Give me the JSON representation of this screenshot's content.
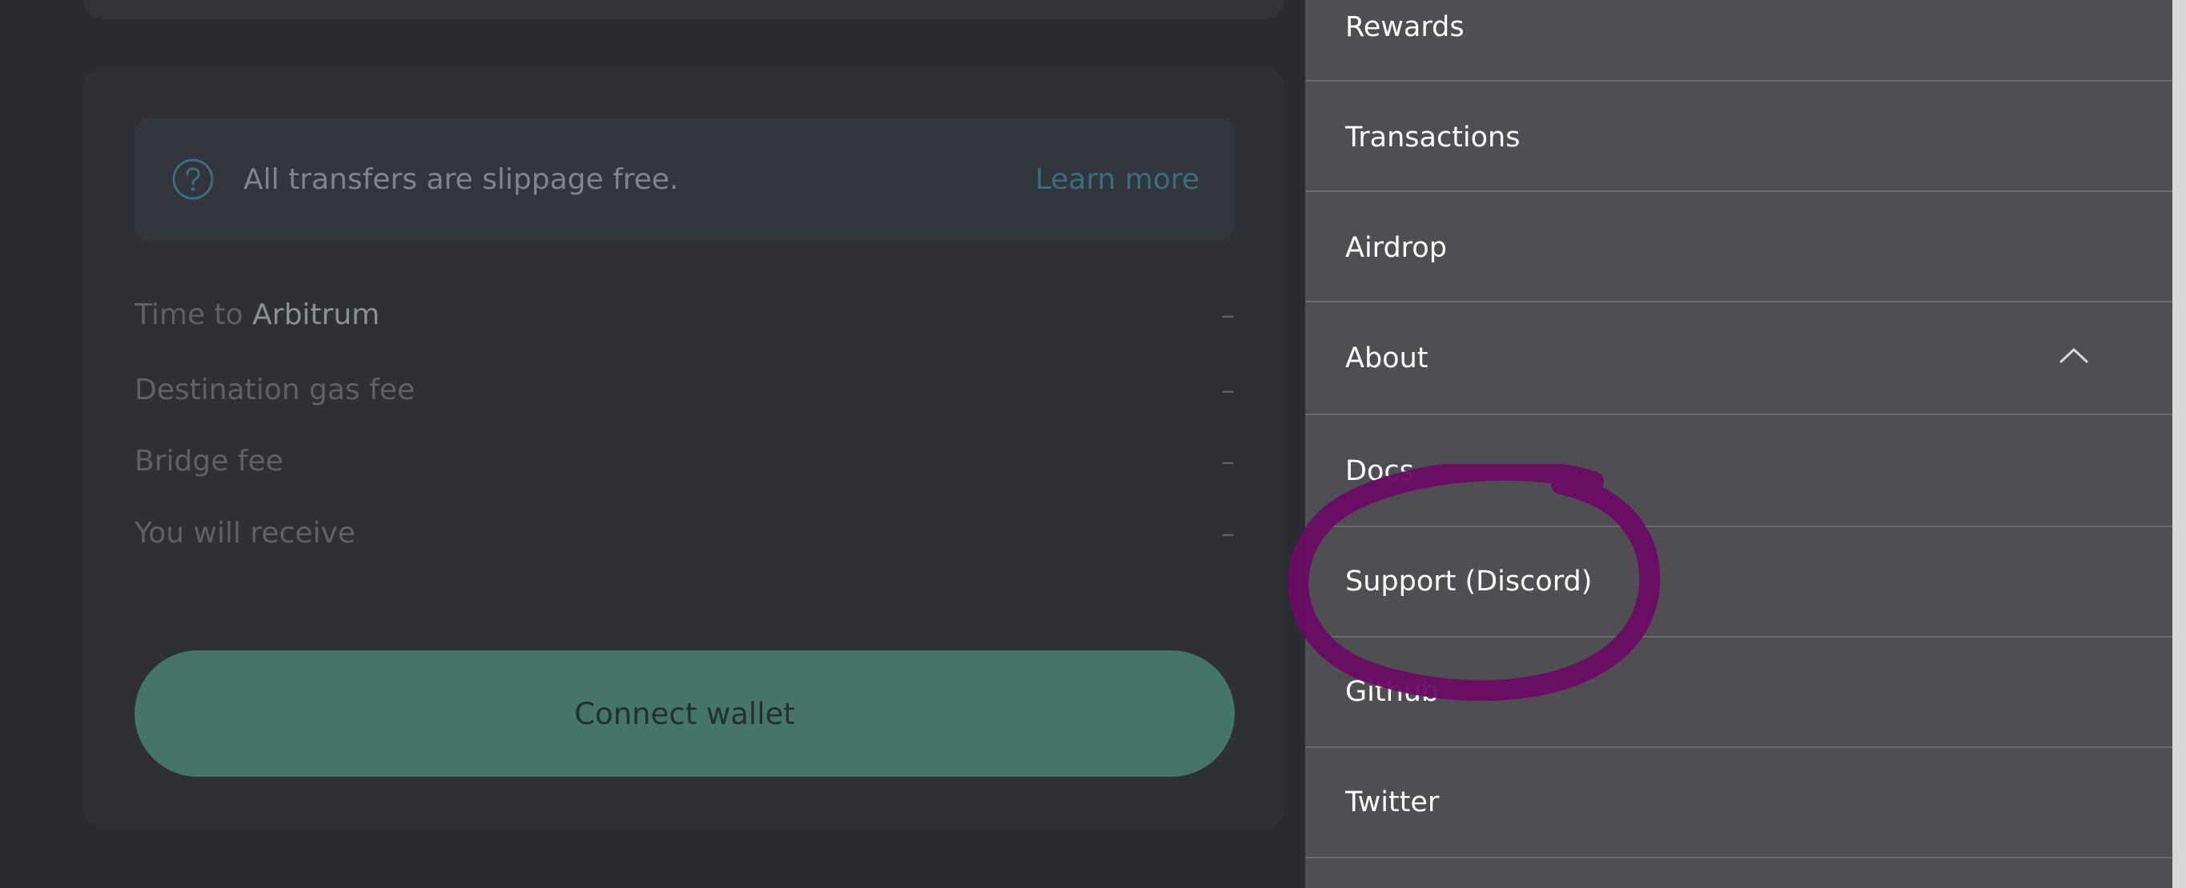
{
  "notice": {
    "text": "All transfers are slippage free.",
    "link": "Learn more"
  },
  "details": {
    "time_prefix": "Time to ",
    "time_network": "Arbitrum",
    "time_value": "–",
    "gas_label": "Destination gas fee",
    "gas_value": "–",
    "bridge_label": "Bridge fee",
    "bridge_value": "–",
    "receive_label": "You will receive",
    "receive_value": "–"
  },
  "connect_button": "Connect wallet",
  "menu": {
    "items": [
      {
        "label": "Rewards"
      },
      {
        "label": "Transactions"
      },
      {
        "label": "Airdrop"
      },
      {
        "label": "About"
      },
      {
        "label": "Docs"
      },
      {
        "label": "Support (Discord)"
      },
      {
        "label": "Github"
      },
      {
        "label": "Twitter"
      }
    ],
    "about_state": "expanded"
  },
  "colors": {
    "accent_button": "#457568",
    "menu_bg": "#4f4e53",
    "annotation": "#6a0b63",
    "link": "#3c6d7b"
  },
  "icons": {
    "notice": "question-circle-icon",
    "about_toggle": "chevron-up-icon"
  }
}
